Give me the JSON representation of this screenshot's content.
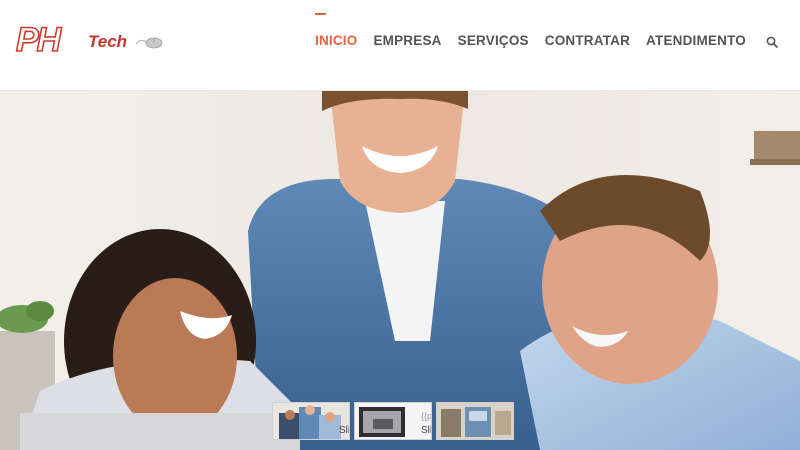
{
  "logo": {
    "mark": "PH",
    "word": "Tech"
  },
  "nav": {
    "items": [
      {
        "label": "INICIO",
        "active": true
      },
      {
        "label": "EMPRESA"
      },
      {
        "label": "SERVIÇOS"
      },
      {
        "label": "CONTRATAR"
      },
      {
        "label": "ATENDIMENTO"
      }
    ],
    "search_icon": "search-icon"
  },
  "hero": {
    "image": "three smiling people looking at a laptop"
  },
  "slider": {
    "thumbnails": [
      {
        "label": "Sli",
        "top_label": ""
      },
      {
        "label": "Sli",
        "top_label": "{{p"
      },
      {
        "label": "",
        "top_label": ""
      }
    ]
  },
  "colors": {
    "accent": "#e4633f",
    "logo_red": "#d03a2f",
    "nav_text": "#545454"
  }
}
